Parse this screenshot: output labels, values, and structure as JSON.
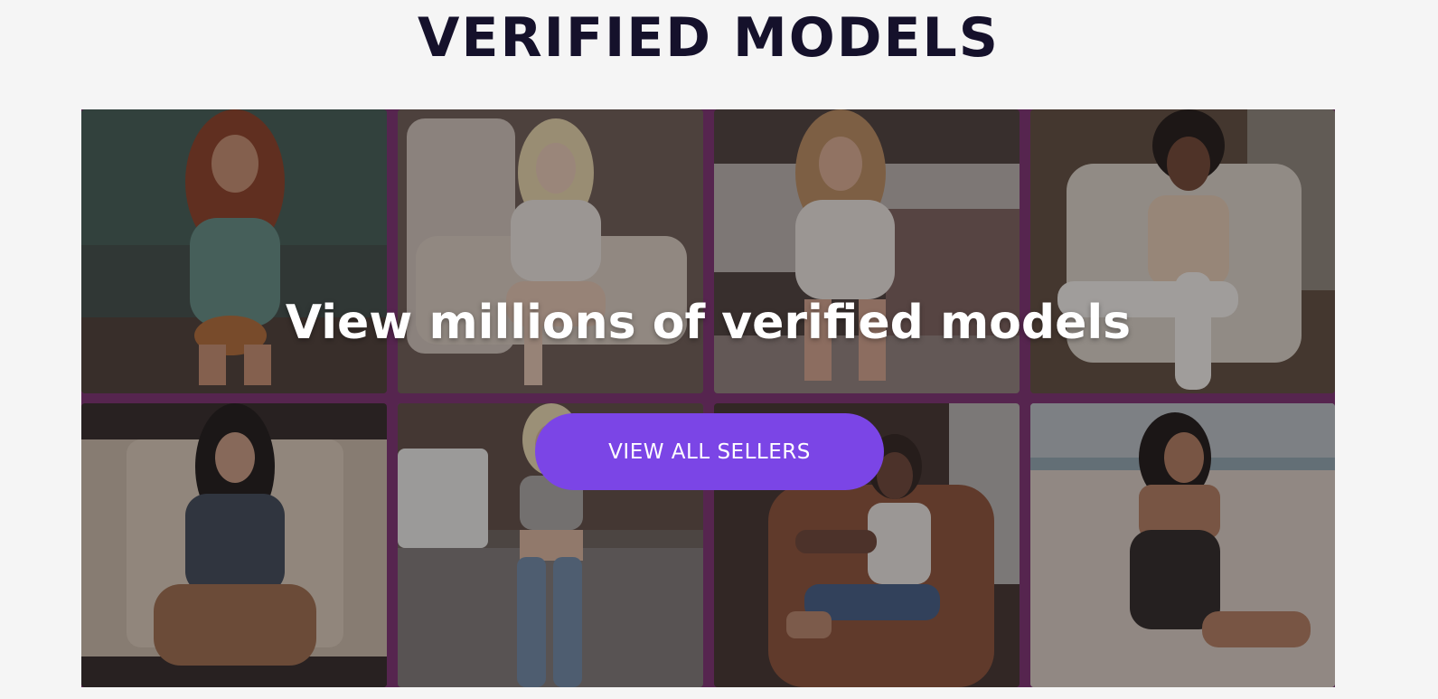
{
  "section": {
    "title": "VERIFIED MODELS"
  },
  "banner": {
    "headline": "View millions of verified models",
    "cta_label": "VIEW ALL SELLERS"
  },
  "colors": {
    "title": "#15112b",
    "grid_background": "#7a2d6e",
    "cta_background": "#7b45e6",
    "cta_text": "#ffffff",
    "headline_text": "#ffffff"
  },
  "photos": [
    {
      "name": "model-photo-1"
    },
    {
      "name": "model-photo-2"
    },
    {
      "name": "model-photo-3"
    },
    {
      "name": "model-photo-4"
    },
    {
      "name": "model-photo-5"
    },
    {
      "name": "model-photo-6"
    },
    {
      "name": "model-photo-7"
    },
    {
      "name": "model-photo-8"
    }
  ]
}
